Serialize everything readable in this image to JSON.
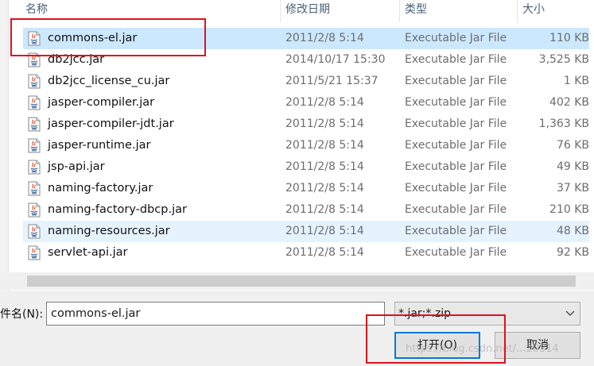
{
  "columns": {
    "name": "名称",
    "date": "修改日期",
    "type": "类型",
    "size": "大小"
  },
  "files": [
    {
      "name": "commons-el.jar",
      "date": "2011/2/8 5:14",
      "type": "Executable Jar File",
      "size": "110 KB",
      "state": "selected"
    },
    {
      "name": "db2jcc.jar",
      "date": "2014/10/17 15:30",
      "type": "Executable Jar File",
      "size": "3,525 KB",
      "state": ""
    },
    {
      "name": "db2jcc_license_cu.jar",
      "date": "2011/5/21 15:37",
      "type": "Executable Jar File",
      "size": "1 KB",
      "state": ""
    },
    {
      "name": "jasper-compiler.jar",
      "date": "2011/2/8 5:14",
      "type": "Executable Jar File",
      "size": "402 KB",
      "state": ""
    },
    {
      "name": "jasper-compiler-jdt.jar",
      "date": "2011/2/8 5:14",
      "type": "Executable Jar File",
      "size": "1,363 KB",
      "state": ""
    },
    {
      "name": "jasper-runtime.jar",
      "date": "2011/2/8 5:14",
      "type": "Executable Jar File",
      "size": "76 KB",
      "state": ""
    },
    {
      "name": "jsp-api.jar",
      "date": "2011/2/8 5:14",
      "type": "Executable Jar File",
      "size": "49 KB",
      "state": ""
    },
    {
      "name": "naming-factory.jar",
      "date": "2011/2/8 5:14",
      "type": "Executable Jar File",
      "size": "37 KB",
      "state": ""
    },
    {
      "name": "naming-factory-dbcp.jar",
      "date": "2011/2/8 5:14",
      "type": "Executable Jar File",
      "size": "210 KB",
      "state": ""
    },
    {
      "name": "naming-resources.jar",
      "date": "2011/2/8 5:14",
      "type": "Executable Jar File",
      "size": "48 KB",
      "state": "hover"
    },
    {
      "name": "servlet-api.jar",
      "date": "2011/2/8 5:14",
      "type": "Executable Jar File",
      "size": "92 KB",
      "state": ""
    }
  ],
  "filename": {
    "label": "件名(N):",
    "value": "commons-el.jar"
  },
  "filetype": {
    "value": "*.jar;*.zip"
  },
  "buttons": {
    "open": "打开(O)",
    "cancel": "取消"
  },
  "watermark": "https://blog.csdn.net/...20314",
  "colors": {
    "selected_row": "#cce8ff",
    "hover_row": "#e5f3ff",
    "annotation": "#e0101c",
    "focus_border": "#0078d7"
  },
  "icons": {
    "file": "java-jar-file-icon",
    "dropdown": "chevron-down-icon"
  }
}
